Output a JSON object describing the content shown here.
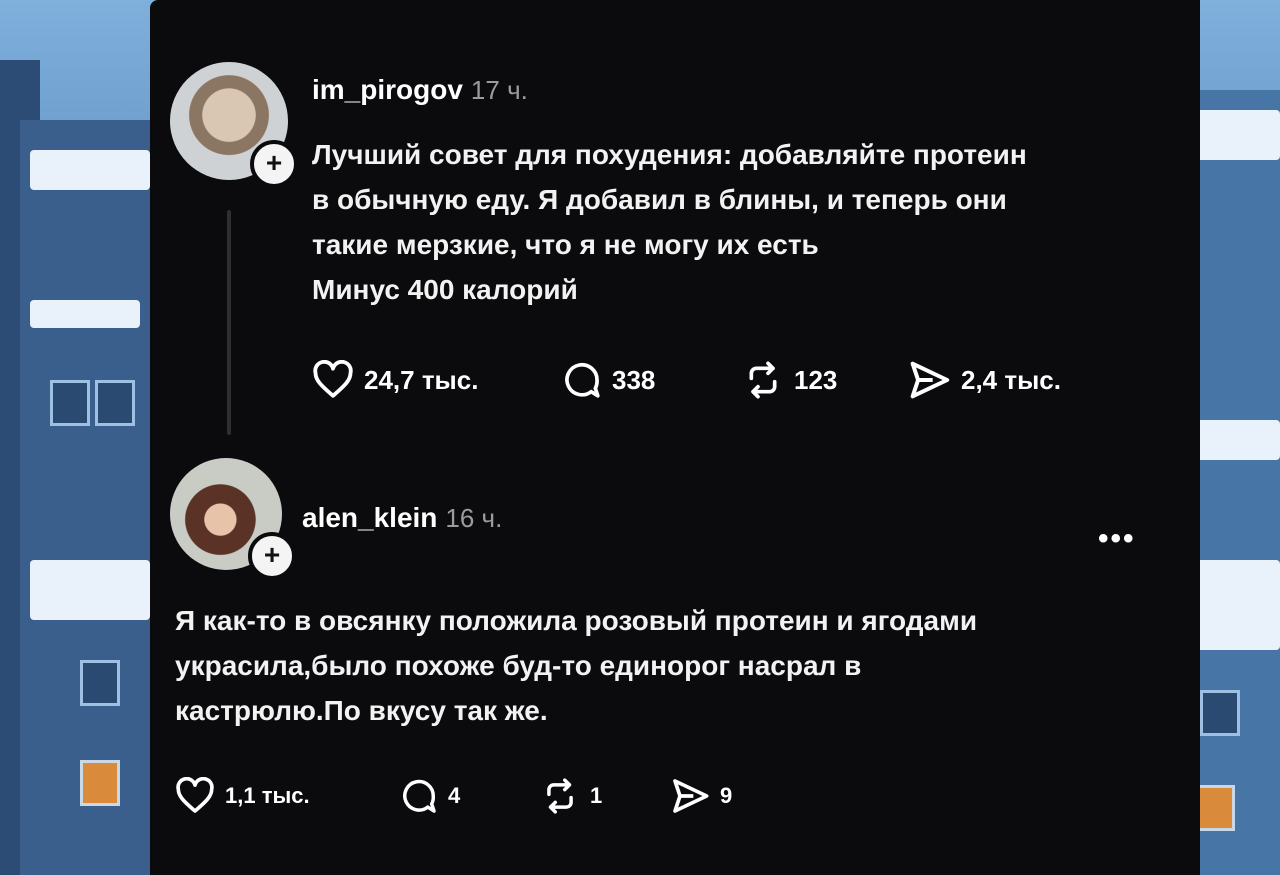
{
  "posts": [
    {
      "username": "im_pirogov",
      "time": "17 ч.",
      "lines": [
        "Лучший совет для похудения: добавляйте протеин",
        "в обычную еду. Я добавил в блины, и теперь они",
        "такие мерзкие, что я не могу их есть",
        "Минус 400 калорий"
      ],
      "stats": {
        "likes": "24,7 тыс.",
        "comments": "338",
        "reposts": "123",
        "shares": "2,4 тыс."
      }
    },
    {
      "username": "alen_klein",
      "time": "16 ч.",
      "more": "•••",
      "lines": [
        "Я как-то в овсянку положила розовый протеин и ягодами",
        "украсила,было похоже буд-то единорог насрал в",
        "кастрюлю.По вкусу так же."
      ],
      "stats": {
        "likes": "1,1 тыс.",
        "comments": "4",
        "reposts": "1",
        "shares": "9"
      }
    }
  ],
  "icons": {
    "like": "heart-icon",
    "comment": "comment-bubble-icon",
    "repost": "repost-icon",
    "share": "send-icon"
  },
  "colors": {
    "screen": "#0b0b0d",
    "text": "#f2f2f2",
    "muted": "#9b9b9b"
  }
}
